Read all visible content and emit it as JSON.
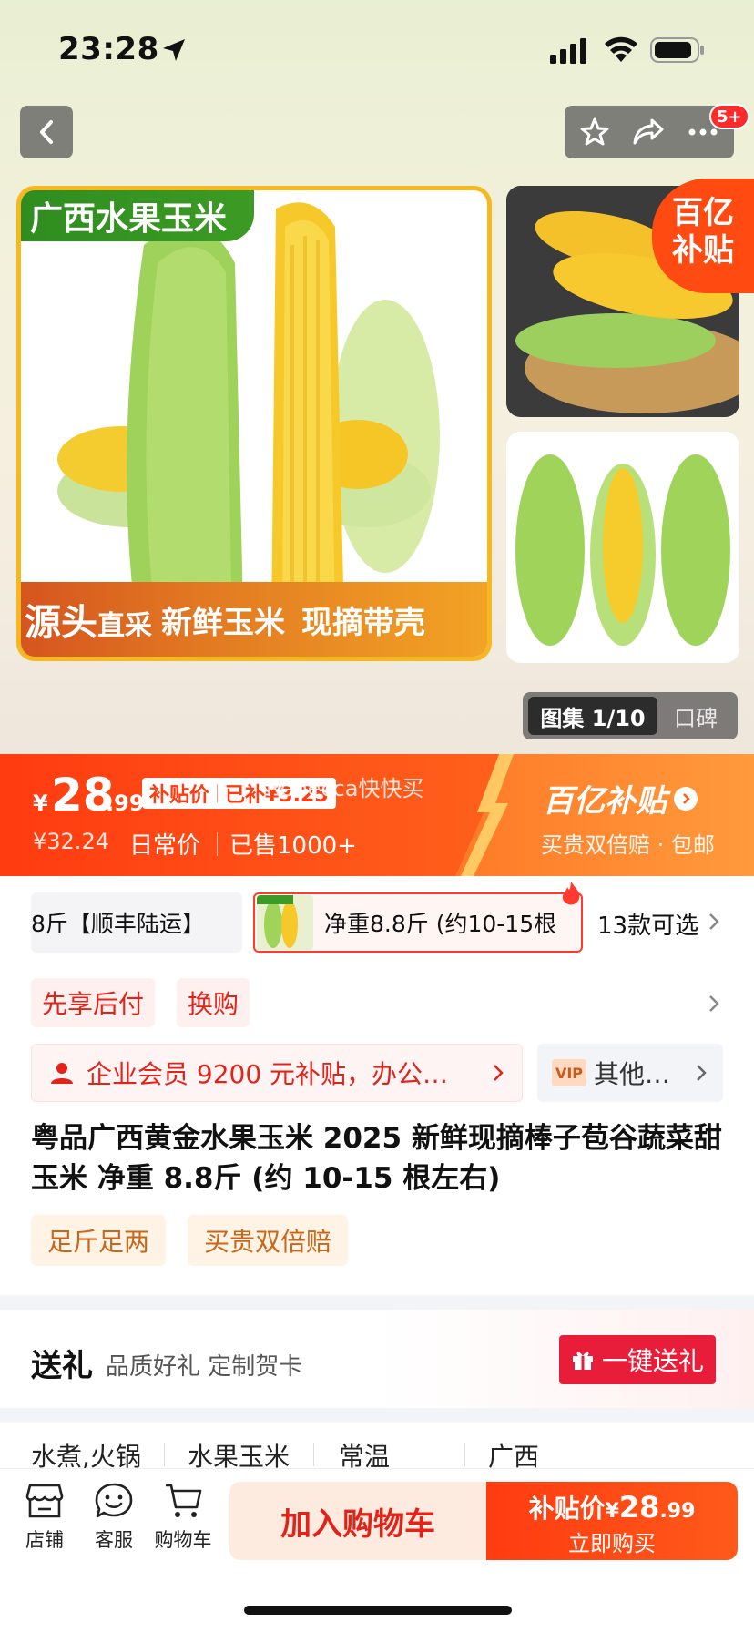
{
  "status_bar": {
    "time": "23:28"
  },
  "nav": {
    "cart_badge": "5+"
  },
  "gallery": {
    "main_tag": "广西水果玉米",
    "bottom_text_1": "源头",
    "bottom_text_1b": "直采",
    "bottom_text_2": "新鲜玉米",
    "bottom_text_3": "现摘带壳",
    "yi_badge_line1": "百亿",
    "yi_badge_line2": "补贴",
    "counter": "图集 1/10",
    "other_tab": "口碑"
  },
  "price": {
    "currency": "¥",
    "integer": "28",
    "decimal": ".99",
    "subsidy_label": "补贴价",
    "subsidy_amount": "已补¥3.25",
    "watermark": "Rebecca快快买",
    "original_price": "¥32.24",
    "original_label": "日常价",
    "sold": "已售1000+",
    "program_title": "百亿补贴",
    "program_sub": "买贵双倍赔 · 包邮"
  },
  "spec": {
    "chip1": "8斤【顺丰陆运】",
    "chip2": "净重8.8斤 (约10-15根",
    "count": "13款可选"
  },
  "services": [
    "先享后付",
    "换购"
  ],
  "member": {
    "text": "企业会员 9200 元补贴，办公…",
    "vip": "VIP",
    "other": "其他…"
  },
  "product_title": "粤品广西黄金水果玉米 2025 新鲜现摘棒子苞谷蔬菜甜玉米 净重 8.8斤 (约 10-15 根左右)",
  "badges": [
    "足斤足两",
    "买贵双倍赔"
  ],
  "gift": {
    "title": "送礼",
    "sub": "品质好礼 定制贺卡",
    "button": "一键送礼"
  },
  "attributes": [
    "水煮,火锅",
    "水果玉米",
    "常温",
    "广西"
  ],
  "bottom_bar": {
    "shop": "店铺",
    "service": "客服",
    "cart": "购物车",
    "add_cart": "加入购物车",
    "buy_label": "补贴价",
    "buy_currency": "¥",
    "buy_int": "28",
    "buy_dec": ".99",
    "buy_action": "立即购买"
  },
  "colors": {
    "accent": "#ff3b10",
    "red": "#e2231a",
    "gold": "#f6b820"
  }
}
